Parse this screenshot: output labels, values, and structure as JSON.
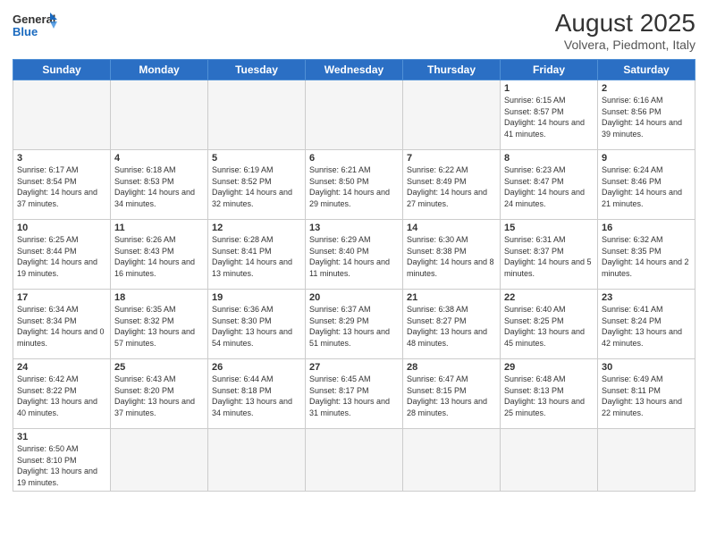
{
  "header": {
    "logo_general": "General",
    "logo_blue": "Blue",
    "month_year": "August 2025",
    "location": "Volvera, Piedmont, Italy"
  },
  "days_of_week": [
    "Sunday",
    "Monday",
    "Tuesday",
    "Wednesday",
    "Thursday",
    "Friday",
    "Saturday"
  ],
  "weeks": [
    [
      {
        "day": "",
        "info": ""
      },
      {
        "day": "",
        "info": ""
      },
      {
        "day": "",
        "info": ""
      },
      {
        "day": "",
        "info": ""
      },
      {
        "day": "",
        "info": ""
      },
      {
        "day": "1",
        "info": "Sunrise: 6:15 AM\nSunset: 8:57 PM\nDaylight: 14 hours and 41 minutes."
      },
      {
        "day": "2",
        "info": "Sunrise: 6:16 AM\nSunset: 8:56 PM\nDaylight: 14 hours and 39 minutes."
      }
    ],
    [
      {
        "day": "3",
        "info": "Sunrise: 6:17 AM\nSunset: 8:54 PM\nDaylight: 14 hours and 37 minutes."
      },
      {
        "day": "4",
        "info": "Sunrise: 6:18 AM\nSunset: 8:53 PM\nDaylight: 14 hours and 34 minutes."
      },
      {
        "day": "5",
        "info": "Sunrise: 6:19 AM\nSunset: 8:52 PM\nDaylight: 14 hours and 32 minutes."
      },
      {
        "day": "6",
        "info": "Sunrise: 6:21 AM\nSunset: 8:50 PM\nDaylight: 14 hours and 29 minutes."
      },
      {
        "day": "7",
        "info": "Sunrise: 6:22 AM\nSunset: 8:49 PM\nDaylight: 14 hours and 27 minutes."
      },
      {
        "day": "8",
        "info": "Sunrise: 6:23 AM\nSunset: 8:47 PM\nDaylight: 14 hours and 24 minutes."
      },
      {
        "day": "9",
        "info": "Sunrise: 6:24 AM\nSunset: 8:46 PM\nDaylight: 14 hours and 21 minutes."
      }
    ],
    [
      {
        "day": "10",
        "info": "Sunrise: 6:25 AM\nSunset: 8:44 PM\nDaylight: 14 hours and 19 minutes."
      },
      {
        "day": "11",
        "info": "Sunrise: 6:26 AM\nSunset: 8:43 PM\nDaylight: 14 hours and 16 minutes."
      },
      {
        "day": "12",
        "info": "Sunrise: 6:28 AM\nSunset: 8:41 PM\nDaylight: 14 hours and 13 minutes."
      },
      {
        "day": "13",
        "info": "Sunrise: 6:29 AM\nSunset: 8:40 PM\nDaylight: 14 hours and 11 minutes."
      },
      {
        "day": "14",
        "info": "Sunrise: 6:30 AM\nSunset: 8:38 PM\nDaylight: 14 hours and 8 minutes."
      },
      {
        "day": "15",
        "info": "Sunrise: 6:31 AM\nSunset: 8:37 PM\nDaylight: 14 hours and 5 minutes."
      },
      {
        "day": "16",
        "info": "Sunrise: 6:32 AM\nSunset: 8:35 PM\nDaylight: 14 hours and 2 minutes."
      }
    ],
    [
      {
        "day": "17",
        "info": "Sunrise: 6:34 AM\nSunset: 8:34 PM\nDaylight: 14 hours and 0 minutes."
      },
      {
        "day": "18",
        "info": "Sunrise: 6:35 AM\nSunset: 8:32 PM\nDaylight: 13 hours and 57 minutes."
      },
      {
        "day": "19",
        "info": "Sunrise: 6:36 AM\nSunset: 8:30 PM\nDaylight: 13 hours and 54 minutes."
      },
      {
        "day": "20",
        "info": "Sunrise: 6:37 AM\nSunset: 8:29 PM\nDaylight: 13 hours and 51 minutes."
      },
      {
        "day": "21",
        "info": "Sunrise: 6:38 AM\nSunset: 8:27 PM\nDaylight: 13 hours and 48 minutes."
      },
      {
        "day": "22",
        "info": "Sunrise: 6:40 AM\nSunset: 8:25 PM\nDaylight: 13 hours and 45 minutes."
      },
      {
        "day": "23",
        "info": "Sunrise: 6:41 AM\nSunset: 8:24 PM\nDaylight: 13 hours and 42 minutes."
      }
    ],
    [
      {
        "day": "24",
        "info": "Sunrise: 6:42 AM\nSunset: 8:22 PM\nDaylight: 13 hours and 40 minutes."
      },
      {
        "day": "25",
        "info": "Sunrise: 6:43 AM\nSunset: 8:20 PM\nDaylight: 13 hours and 37 minutes."
      },
      {
        "day": "26",
        "info": "Sunrise: 6:44 AM\nSunset: 8:18 PM\nDaylight: 13 hours and 34 minutes."
      },
      {
        "day": "27",
        "info": "Sunrise: 6:45 AM\nSunset: 8:17 PM\nDaylight: 13 hours and 31 minutes."
      },
      {
        "day": "28",
        "info": "Sunrise: 6:47 AM\nSunset: 8:15 PM\nDaylight: 13 hours and 28 minutes."
      },
      {
        "day": "29",
        "info": "Sunrise: 6:48 AM\nSunset: 8:13 PM\nDaylight: 13 hours and 25 minutes."
      },
      {
        "day": "30",
        "info": "Sunrise: 6:49 AM\nSunset: 8:11 PM\nDaylight: 13 hours and 22 minutes."
      }
    ],
    [
      {
        "day": "31",
        "info": "Sunrise: 6:50 AM\nSunset: 8:10 PM\nDaylight: 13 hours and 19 minutes."
      },
      {
        "day": "",
        "info": ""
      },
      {
        "day": "",
        "info": ""
      },
      {
        "day": "",
        "info": ""
      },
      {
        "day": "",
        "info": ""
      },
      {
        "day": "",
        "info": ""
      },
      {
        "day": "",
        "info": ""
      }
    ]
  ]
}
